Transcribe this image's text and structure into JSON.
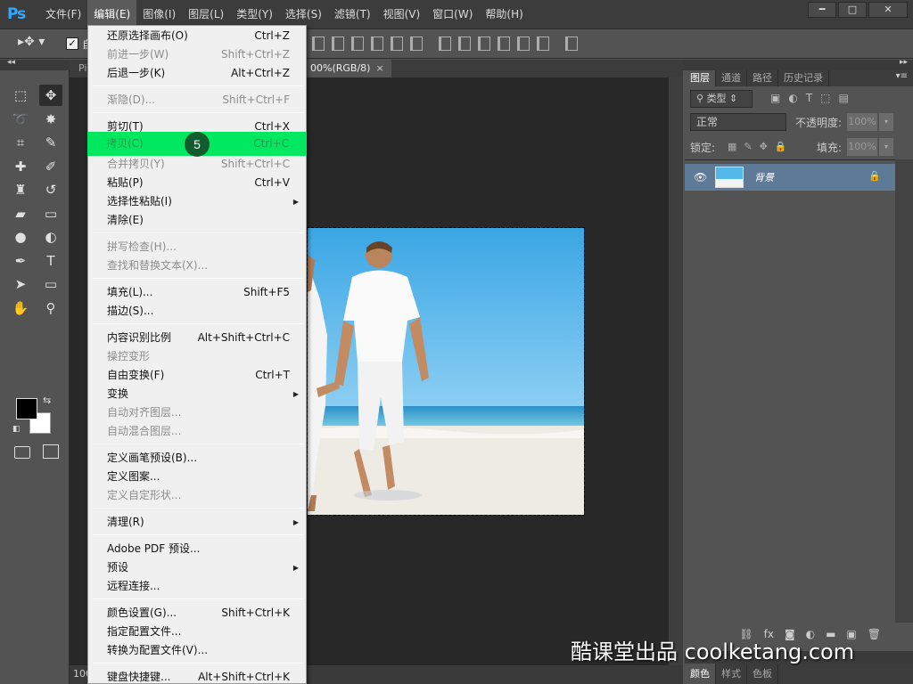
{
  "app": {
    "logo": "Ps"
  },
  "menubar": {
    "items": [
      "文件(F)",
      "编辑(E)",
      "图像(I)",
      "图层(L)",
      "类型(Y)",
      "选择(S)",
      "滤镜(T)",
      "视图(V)",
      "窗口(W)",
      "帮助(H)"
    ],
    "active_index": 1
  },
  "window_controls": {
    "minimize": "━",
    "maximize": "□",
    "close": "✕"
  },
  "options_bar": {
    "checkbox_label": "自"
  },
  "document": {
    "tab_left": "Pi",
    "tab_active": "00%(RGB/8)",
    "tab_close": "×",
    "zoom": "100"
  },
  "edit_menu": {
    "items": [
      {
        "label": "还原选择画布(O)",
        "shortcut": "Ctrl+Z",
        "enabled": true
      },
      {
        "label": "前进一步(W)",
        "shortcut": "Shift+Ctrl+Z",
        "enabled": false
      },
      {
        "label": "后退一步(K)",
        "shortcut": "Alt+Ctrl+Z",
        "enabled": true
      },
      {
        "label": "渐隐(D)...",
        "shortcut": "Shift+Ctrl+F",
        "enabled": false
      },
      {
        "label": "剪切(T)",
        "shortcut": "Ctrl+X",
        "enabled": true
      },
      {
        "label": "拷贝(C)",
        "shortcut": "Ctrl+C",
        "enabled": true,
        "highlighted": true
      },
      {
        "label": "合并拷贝(Y)",
        "shortcut": "Shift+Ctrl+C",
        "enabled": false
      },
      {
        "label": "粘贴(P)",
        "shortcut": "Ctrl+V",
        "enabled": true
      },
      {
        "label": "选择性粘贴(I)",
        "shortcut": "",
        "enabled": true,
        "submenu": true
      },
      {
        "label": "清除(E)",
        "shortcut": "",
        "enabled": true
      },
      {
        "label": "拼写检查(H)...",
        "shortcut": "",
        "enabled": false
      },
      {
        "label": "查找和替换文本(X)...",
        "shortcut": "",
        "enabled": false
      },
      {
        "label": "填充(L)...",
        "shortcut": "Shift+F5",
        "enabled": true
      },
      {
        "label": "描边(S)...",
        "shortcut": "",
        "enabled": true
      },
      {
        "label": "内容识别比例",
        "shortcut": "Alt+Shift+Ctrl+C",
        "enabled": true
      },
      {
        "label": "操控变形",
        "shortcut": "",
        "enabled": false
      },
      {
        "label": "自由变换(F)",
        "shortcut": "Ctrl+T",
        "enabled": true
      },
      {
        "label": "变换",
        "shortcut": "",
        "enabled": true,
        "submenu": true
      },
      {
        "label": "自动对齐图层...",
        "shortcut": "",
        "enabled": false
      },
      {
        "label": "自动混合图层...",
        "shortcut": "",
        "enabled": false
      },
      {
        "label": "定义画笔预设(B)...",
        "shortcut": "",
        "enabled": true
      },
      {
        "label": "定义图案...",
        "shortcut": "",
        "enabled": true
      },
      {
        "label": "定义自定形状...",
        "shortcut": "",
        "enabled": false
      },
      {
        "label": "清理(R)",
        "shortcut": "",
        "enabled": true,
        "submenu": true
      },
      {
        "label": "Adobe PDF 预设...",
        "shortcut": "",
        "enabled": true
      },
      {
        "label": "预设",
        "shortcut": "",
        "enabled": true,
        "submenu": true
      },
      {
        "label": "远程连接...",
        "shortcut": "",
        "enabled": true
      },
      {
        "label": "颜色设置(G)...",
        "shortcut": "Shift+Ctrl+K",
        "enabled": true
      },
      {
        "label": "指定配置文件...",
        "shortcut": "",
        "enabled": true
      },
      {
        "label": "转换为配置文件(V)...",
        "shortcut": "",
        "enabled": true
      },
      {
        "label": "键盘快捷键...",
        "shortcut": "Alt+Shift+Ctrl+K",
        "enabled": true
      }
    ],
    "step_badge": "5",
    "highlight_color": "#00e85f"
  },
  "layers_panel": {
    "tabs": [
      "图层",
      "通道",
      "路径",
      "历史记录"
    ],
    "filter_label": "类型",
    "blend_mode": "正常",
    "opacity_label": "不透明度:",
    "opacity_value": "100%",
    "lock_label": "锁定:",
    "fill_label": "填充:",
    "fill_value": "100%",
    "layer_name": "背景"
  },
  "bottom_panel": {
    "tabs": [
      "颜色",
      "样式",
      "色板"
    ]
  },
  "watermark": "酷课堂出品 coolketang.com",
  "colors": {
    "accent": "#31a8ff",
    "selected_layer": "#5f7a96",
    "menu_bg": "#f0f0f0"
  }
}
